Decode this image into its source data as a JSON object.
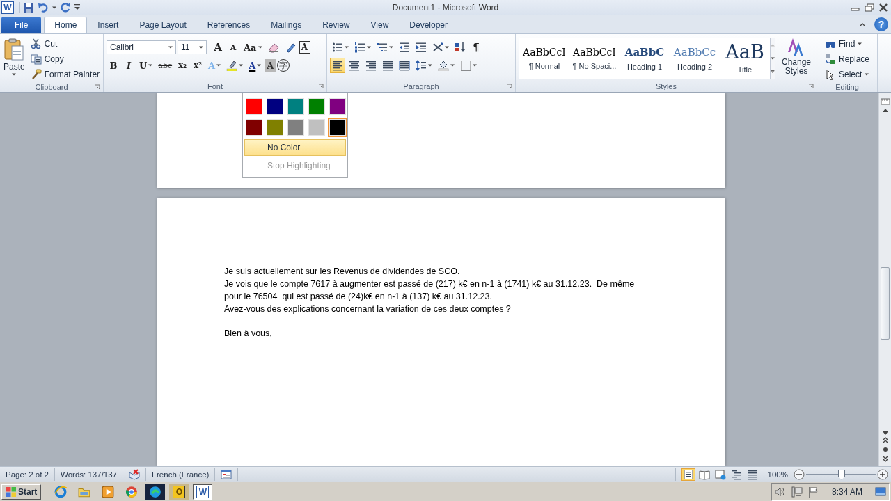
{
  "window": {
    "app_icon": "W",
    "title": "Document1 - Microsoft Word",
    "help": "?"
  },
  "tabs": [
    {
      "label": "File",
      "kind": "backstage",
      "selected": false
    },
    {
      "label": "Home",
      "kind": "tab",
      "selected": true
    },
    {
      "label": "Insert",
      "kind": "tab",
      "selected": false
    },
    {
      "label": "Page Layout",
      "kind": "tab",
      "selected": false
    },
    {
      "label": "References",
      "kind": "tab",
      "selected": false
    },
    {
      "label": "Mailings",
      "kind": "tab",
      "selected": false
    },
    {
      "label": "Review",
      "kind": "tab",
      "selected": false
    },
    {
      "label": "View",
      "kind": "tab",
      "selected": false
    },
    {
      "label": "Developer",
      "kind": "tab",
      "selected": false
    }
  ],
  "ribbon": {
    "clipboard": {
      "title": "Clipboard",
      "paste": "Paste",
      "items": [
        {
          "label": "Cut",
          "kind": "cut"
        },
        {
          "label": "Copy",
          "kind": "copy"
        },
        {
          "label": "Format Painter",
          "kind": "painter"
        }
      ]
    },
    "font": {
      "title": "Font",
      "font_name": "Calibri",
      "font_size": "11",
      "row1": [
        {
          "kind": "grow",
          "glyph": "A"
        },
        {
          "kind": "shrink",
          "glyph": "A"
        },
        {
          "kind": "case",
          "glyph": "Aa"
        },
        {
          "kind": "clear"
        },
        {
          "kind": "phonetic"
        },
        {
          "kind": "border",
          "glyph": "A"
        }
      ],
      "row2": [
        {
          "kind": "bold",
          "glyph": "B"
        },
        {
          "kind": "italic",
          "glyph": "I"
        },
        {
          "kind": "underline",
          "glyph": "U"
        },
        {
          "kind": "strike",
          "glyph": "abc"
        },
        {
          "kind": "sub",
          "glyph": "x₂"
        },
        {
          "kind": "sup",
          "glyph": "x²"
        },
        {
          "kind": "effects",
          "glyph": "A"
        },
        {
          "kind": "highlight"
        },
        {
          "kind": "fontcolor",
          "glyph": "A"
        },
        {
          "kind": "shade",
          "glyph": "A"
        },
        {
          "kind": "enclose",
          "glyph": "字"
        }
      ]
    },
    "paragraph": {
      "title": "Paragraph",
      "row1": [
        {
          "kind": "bullets"
        },
        {
          "kind": "numbering"
        },
        {
          "kind": "multilevel"
        },
        {
          "kind": "outdent"
        },
        {
          "kind": "indent"
        },
        {
          "kind": "asian"
        },
        {
          "kind": "sort"
        },
        {
          "kind": "marks",
          "glyph": "¶"
        }
      ],
      "row2": [
        {
          "kind": "left",
          "selected": true
        },
        {
          "kind": "center",
          "selected": false
        },
        {
          "kind": "right",
          "selected": false
        },
        {
          "kind": "justify",
          "selected": false
        },
        {
          "kind": "distribute",
          "selected": false
        },
        {
          "kind": "spacing"
        },
        {
          "kind": "bucket"
        },
        {
          "kind": "borders"
        }
      ]
    },
    "styles": {
      "title": "Styles",
      "items": [
        {
          "sample": "AaBbCcI",
          "name": "¶ Normal",
          "kind": "normal"
        },
        {
          "sample": "AaBbCcI",
          "name": "¶ No Spaci...",
          "kind": "nospacing"
        },
        {
          "sample": "AaBbC",
          "name": "Heading 1",
          "kind": "h1"
        },
        {
          "sample": "AaBbCc",
          "name": "Heading 2",
          "kind": "h2"
        },
        {
          "sample": "AaB",
          "name": "Title",
          "kind": "title"
        }
      ],
      "change": "Change Styles"
    },
    "editing": {
      "title": "Editing",
      "items": [
        {
          "label": "Find",
          "kind": "find"
        },
        {
          "label": "Replace",
          "kind": "replace"
        },
        {
          "label": "Select",
          "kind": "select"
        }
      ]
    }
  },
  "highlight_menu": {
    "colors": [
      {
        "color": "#ff0000",
        "selected": false
      },
      {
        "color": "#000080",
        "selected": false
      },
      {
        "color": "#008080",
        "selected": false
      },
      {
        "color": "#008000",
        "selected": false
      },
      {
        "color": "#800080",
        "selected": false
      },
      {
        "color": "#800000",
        "selected": false
      },
      {
        "color": "#808000",
        "selected": false
      },
      {
        "color": "#808080",
        "selected": false
      },
      {
        "color": "#c0c0c0",
        "selected": false
      },
      {
        "color": "#000000",
        "selected": true
      }
    ],
    "no_color": {
      "label": "No Color",
      "selected": true
    },
    "stop": {
      "label": "Stop Highlighting",
      "disabled": true
    }
  },
  "document": {
    "paragraphs": [
      {
        "text": "Je suis actuellement sur les Revenus de dividendes de SCO.",
        "kind": "line"
      },
      {
        "text": "Je vois que le compte 7617 à augmenter est passé de (217) k€ en n-1 à (1741) k€ au 31.12.23.  De même",
        "kind": "line"
      },
      {
        "text": "pour le 76504  qui est passé de (24)k€ en n-1 à (137) k€ au 31.12.23.",
        "kind": "line"
      },
      {
        "text": "Avez-vous des explications concernant la variation de ces deux comptes ?",
        "kind": "line"
      },
      {
        "text": "Bien à vous,",
        "kind": "closing"
      }
    ]
  },
  "status_bar": {
    "page": "Page: 2 of 2",
    "words": "Words: 137/137",
    "language": "French (France)",
    "views": [
      {
        "kind": "print",
        "selected": true
      },
      {
        "kind": "reading",
        "selected": false
      },
      {
        "kind": "web",
        "selected": false
      },
      {
        "kind": "outline",
        "selected": false
      },
      {
        "kind": "draft",
        "selected": false
      }
    ],
    "zoom": "100%",
    "zoom_slider": {
      "level": 0.5
    }
  },
  "taskbar": {
    "start": "Start",
    "apps": [
      {
        "kind": "ie",
        "selected": false
      },
      {
        "kind": "folder",
        "selected": false
      },
      {
        "kind": "media",
        "selected": false
      },
      {
        "kind": "chrome",
        "selected": false
      },
      {
        "kind": "edge",
        "selected": false
      },
      {
        "kind": "outlook",
        "glyph": "O",
        "selected": false
      },
      {
        "kind": "word",
        "glyph": "W",
        "selected": true
      }
    ],
    "tray": [
      {
        "kind": "volume"
      },
      {
        "kind": "network"
      },
      {
        "kind": "flag"
      }
    ],
    "clock": "8:34 AM"
  }
}
